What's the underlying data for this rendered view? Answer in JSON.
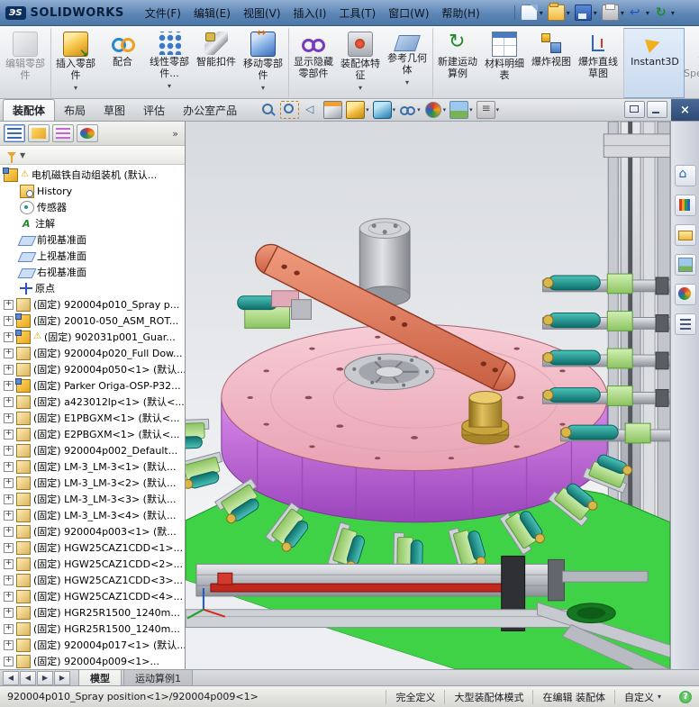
{
  "colors": {
    "titlebar_blue": "#5d86b6",
    "base_plate_green": "#3fd246",
    "disc_pink": "#f0b6c2",
    "drum_purple": "#b75fd0",
    "cylinder_teal": "#18958d",
    "arm_orange": "#e07a5f",
    "shaft_red": "#c1281d"
  },
  "icons": {
    "caret": "▾",
    "close": "×",
    "help": "?",
    "overflow": "»",
    "filter_caret": "▼",
    "expander": "+",
    "warning": "⚠",
    "nav_prev": "◀",
    "nav_next": "▶"
  },
  "titlebar": {
    "logo": "ЭS",
    "brand": "SOLIDWORKS",
    "menus": [
      "文件(F)",
      "编辑(E)",
      "视图(V)",
      "插入(I)",
      "工具(T)",
      "窗口(W)",
      "帮助(H)"
    ],
    "quick_icons": [
      {
        "name": "new-document-icon",
        "cls": "qi-new"
      },
      {
        "name": "open-icon",
        "cls": "qi-open"
      },
      {
        "name": "save-icon",
        "cls": "qi-save"
      },
      {
        "name": "print-icon",
        "cls": "qi-print"
      },
      {
        "name": "undo-icon",
        "cls": "qi-undo"
      },
      {
        "name": "rebuild-icon",
        "cls": "qi-rebuild"
      }
    ]
  },
  "ribbon": {
    "buttons": [
      {
        "label": "编辑零部件",
        "icon": "edit-component-icon",
        "cls": "ri-edit",
        "state": "dis",
        "caret": ""
      },
      {
        "label": "插入零部件",
        "icon": "insert-component-icon",
        "cls": "ri-insert",
        "state": "",
        "caret": "caret"
      },
      {
        "label": "配合",
        "icon": "mate-icon",
        "cls": "ri-mate",
        "state": "",
        "caret": ""
      },
      {
        "label": "线性零部件...",
        "icon": "linear-component-pattern-icon",
        "cls": "ri-pattern",
        "state": "",
        "caret": "caret"
      },
      {
        "label": "智能扣件",
        "icon": "smart-fasteners-icon",
        "cls": "ri-fasteners",
        "state": "",
        "caret": ""
      },
      {
        "label": "移动零部件",
        "icon": "move-component-icon",
        "cls": "ri-move",
        "state": "",
        "caret": "caret"
      },
      {
        "label": "显示隐藏零部件",
        "icon": "show-hidden-components-icon",
        "cls": "ri-show",
        "state": "",
        "caret": ""
      },
      {
        "label": "装配体特征",
        "icon": "assembly-features-icon",
        "cls": "ri-feat",
        "state": "",
        "caret": "caret"
      },
      {
        "label": "参考几何体",
        "icon": "reference-geometry-icon",
        "cls": "ri-ref",
        "state": "",
        "caret": "caret"
      },
      {
        "label": "新建运动算例",
        "icon": "new-motion-study-icon",
        "cls": "ri-motion",
        "state": "",
        "caret": ""
      },
      {
        "label": "材料明细表",
        "icon": "bill-of-materials-icon",
        "cls": "ri-bom",
        "state": "",
        "caret": ""
      },
      {
        "label": "爆炸视图",
        "icon": "exploded-view-icon",
        "cls": "ri-explode",
        "state": "",
        "caret": ""
      },
      {
        "label": "爆炸直线草图",
        "icon": "explode-line-sketch-icon",
        "cls": "ri-lines",
        "state": "",
        "caret": ""
      },
      {
        "label": "Instant3D",
        "icon": "instant3d-icon",
        "cls": "ri-i3d",
        "state": "act",
        "caret": ""
      },
      {
        "label": "更新Speedpak",
        "icon": "update-speedpak-icon",
        "cls": "ri-speedpak",
        "state": "dis",
        "caret": ""
      }
    ]
  },
  "command_tabs": {
    "tabs": [
      {
        "label": "装配体",
        "state": "act"
      },
      {
        "label": "布局",
        "state": ""
      },
      {
        "label": "草图",
        "state": ""
      },
      {
        "label": "评估",
        "state": ""
      },
      {
        "label": "办公室产品",
        "state": ""
      }
    ]
  },
  "view_tools": [
    {
      "name": "zoom-fit-icon",
      "cls": "vi-zoomfit",
      "caret": ""
    },
    {
      "name": "zoom-area-icon",
      "cls": "vi-zoomarea",
      "caret": ""
    },
    {
      "name": "previous-view-icon",
      "cls": "vi-prev",
      "caret": ""
    },
    {
      "name": "section-view-icon",
      "cls": "vi-section",
      "caret": ""
    },
    {
      "name": "view-orientation-icon",
      "cls": "vi-orient",
      "caret": "caret"
    },
    {
      "name": "display-style-icon",
      "cls": "vi-style",
      "caret": "caret"
    },
    {
      "name": "hide-show-items-icon",
      "cls": "vi-hideshow",
      "caret": "caret"
    },
    {
      "name": "edit-appearance-icon",
      "cls": "vi-appearance",
      "caret": "caret"
    },
    {
      "name": "apply-scene-icon",
      "cls": "vi-scene",
      "caret": "caret"
    },
    {
      "name": "view-settings-icon",
      "cls": "vi-settings",
      "caret": "caret"
    }
  ],
  "window_controls": {
    "restore": "restore-window-icon",
    "minimize": "minimize-window-icon",
    "close": "close-icon"
  },
  "feature_panel": {
    "tabs": [
      {
        "name": "feature-manager-tab-icon",
        "cls": "ph-feat on"
      },
      {
        "name": "property-manager-tab-icon",
        "cls": "ph-prop"
      },
      {
        "name": "configuration-manager-tab-icon",
        "cls": "ph-config"
      },
      {
        "name": "display-manager-tab-icon",
        "cls": "ph-display"
      }
    ],
    "tree": [
      {
        "label": "电机磁铁自动组装机 (默认...",
        "cls": "root warn",
        "icon": "ic-asm"
      },
      {
        "label": "History",
        "cls": "child",
        "icon": "ic-hist"
      },
      {
        "label": "传感器",
        "cls": "child",
        "icon": "ic-sens"
      },
      {
        "label": "注解",
        "cls": "child",
        "icon": "ic-note"
      },
      {
        "label": "前视基准面",
        "cls": "child",
        "icon": "ic-plane"
      },
      {
        "label": "上视基准面",
        "cls": "child",
        "icon": "ic-plane"
      },
      {
        "label": "右视基准面",
        "cls": "child",
        "icon": "ic-plane"
      },
      {
        "label": "原点",
        "cls": "child",
        "icon": "ic-origin"
      },
      {
        "label": "(固定) 920004p010_Spray p...",
        "cls": "fixed",
        "icon": "ic-part"
      },
      {
        "label": "(固定) 20010-050_ASM_ROT...",
        "cls": "fixed",
        "icon": "ic-asm2"
      },
      {
        "label": "(固定) 902031p001_Guar...",
        "cls": "fixed warn",
        "icon": "ic-asm2"
      },
      {
        "label": "(固定) 920004p020_Full Dow...",
        "cls": "fixed",
        "icon": "ic-part"
      },
      {
        "label": "(固定) 920004p050<1> (默认...",
        "cls": "fixed",
        "icon": "ic-part"
      },
      {
        "label": "(固定) Parker Origa-OSP-P32...",
        "cls": "fixed",
        "icon": "ic-asm2"
      },
      {
        "label": "(固定) a423012lp<1> (默认<...",
        "cls": "fixed",
        "icon": "ic-part"
      },
      {
        "label": "(固定) E1PBGXM<1> (默认<...",
        "cls": "fixed",
        "icon": "ic-part"
      },
      {
        "label": "(固定) E2PBGXM<1> (默认<...",
        "cls": "fixed",
        "icon": "ic-part"
      },
      {
        "label": "(固定) 920004p002_Default...",
        "cls": "fixed",
        "icon": "ic-part"
      },
      {
        "label": "(固定) LM-3_LM-3<1> (默认...",
        "cls": "fixed",
        "icon": "ic-part"
      },
      {
        "label": "(固定) LM-3_LM-3<2> (默认...",
        "cls": "fixed",
        "icon": "ic-part"
      },
      {
        "label": "(固定) LM-3_LM-3<3> (默认...",
        "cls": "fixed",
        "icon": "ic-part"
      },
      {
        "label": "(固定) LM-3_LM-3<4> (默认...",
        "cls": "fixed",
        "icon": "ic-part"
      },
      {
        "label": "(固定) 920004p003<1> (默...",
        "cls": "fixed",
        "icon": "ic-part"
      },
      {
        "label": "(固定) HGW25CAZ1CDD<1>...",
        "cls": "fixed",
        "icon": "ic-part"
      },
      {
        "label": "(固定) HGW25CAZ1CDD<2>...",
        "cls": "fixed",
        "icon": "ic-part"
      },
      {
        "label": "(固定) HGW25CAZ1CDD<3>...",
        "cls": "fixed",
        "icon": "ic-part"
      },
      {
        "label": "(固定) HGW25CAZ1CDD<4>...",
        "cls": "fixed",
        "icon": "ic-part"
      },
      {
        "label": "(固定) HGR25R1500_1240m...",
        "cls": "fixed",
        "icon": "ic-part"
      },
      {
        "label": "(固定) HGR25R1500_1240m...",
        "cls": "fixed",
        "icon": "ic-part"
      },
      {
        "label": "(固定) 920004p017<1> (默认...",
        "cls": "fixed",
        "icon": "ic-part"
      },
      {
        "label": "(固定) 920004p009<1>...",
        "cls": "fixed",
        "icon": "ic-part"
      }
    ]
  },
  "taskpane": [
    {
      "name": "solidworks-resources-icon",
      "cls": "tp-home"
    },
    {
      "name": "design-library-icon",
      "cls": "tp-lib"
    },
    {
      "name": "file-explorer-icon",
      "cls": "tp-files"
    },
    {
      "name": "view-palette-icon",
      "cls": "tp-palette"
    },
    {
      "name": "appearances-icon",
      "cls": "tp-appear"
    },
    {
      "name": "custom-properties-icon",
      "cls": "tp-props"
    }
  ],
  "model_tabs": {
    "nav_icons": [
      "first-tab-icon",
      "previous-tab-icon",
      "next-tab-icon",
      "last-tab-icon"
    ],
    "tabs": [
      {
        "label": "模型",
        "state": "act"
      },
      {
        "label": "运动算例1",
        "state": ""
      }
    ]
  },
  "statusbar": {
    "selection": "920004p010_Spray position<1>/920004p009<1>",
    "defined": "完全定义",
    "mode": "大型装配体模式",
    "editing": "在编辑 装配体",
    "custom": "自定义",
    "help": "?"
  }
}
